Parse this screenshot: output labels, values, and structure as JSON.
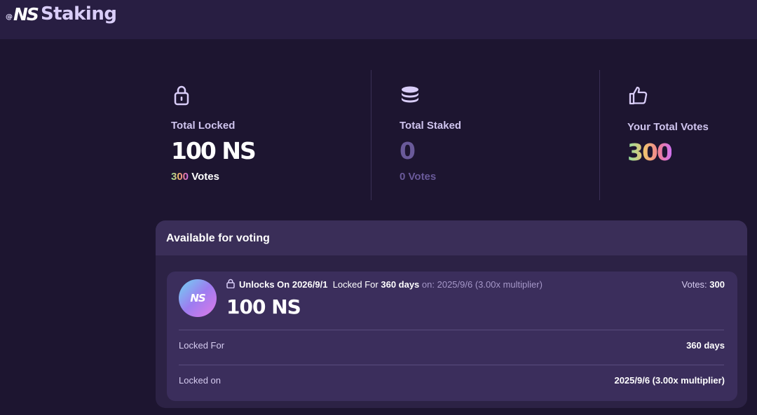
{
  "header": {
    "logo_at": "@",
    "logo_ns": "NS",
    "title": "Staking"
  },
  "stats": {
    "total_locked": {
      "icon": "lock-icon",
      "label": "Total Locked",
      "value": "100 NS",
      "votes_count": "300",
      "votes_label": "Votes"
    },
    "total_staked": {
      "icon": "coins-stack-icon",
      "label": "Total Staked",
      "value": "0",
      "votes_text": "0 Votes"
    },
    "total_votes": {
      "icon": "thumbs-up-icon",
      "label": "Your Total Votes",
      "value": "300"
    }
  },
  "voting": {
    "title": "Available for voting",
    "item": {
      "token_icon_text": "NS",
      "unlock_text": "Unlocks On 2026/9/1",
      "locked_for_prefix": "Locked For",
      "locked_for_value": "360 days",
      "locked_on_text": "on: 2025/9/6 (3.00x multiplier)",
      "votes_label": "Votes:",
      "votes_value": "300",
      "amount": "100 NS",
      "rows": [
        {
          "label": "Locked For",
          "value": "360 days"
        },
        {
          "label": "Locked on",
          "value": "2025/9/6 (3.00x multiplier)"
        }
      ]
    }
  },
  "colors": {
    "background": "#1d1530",
    "topbar": "#281e42",
    "panel": "#2c2245",
    "card": "#3b2e5c",
    "muted_purple": "#6a5a9a"
  }
}
